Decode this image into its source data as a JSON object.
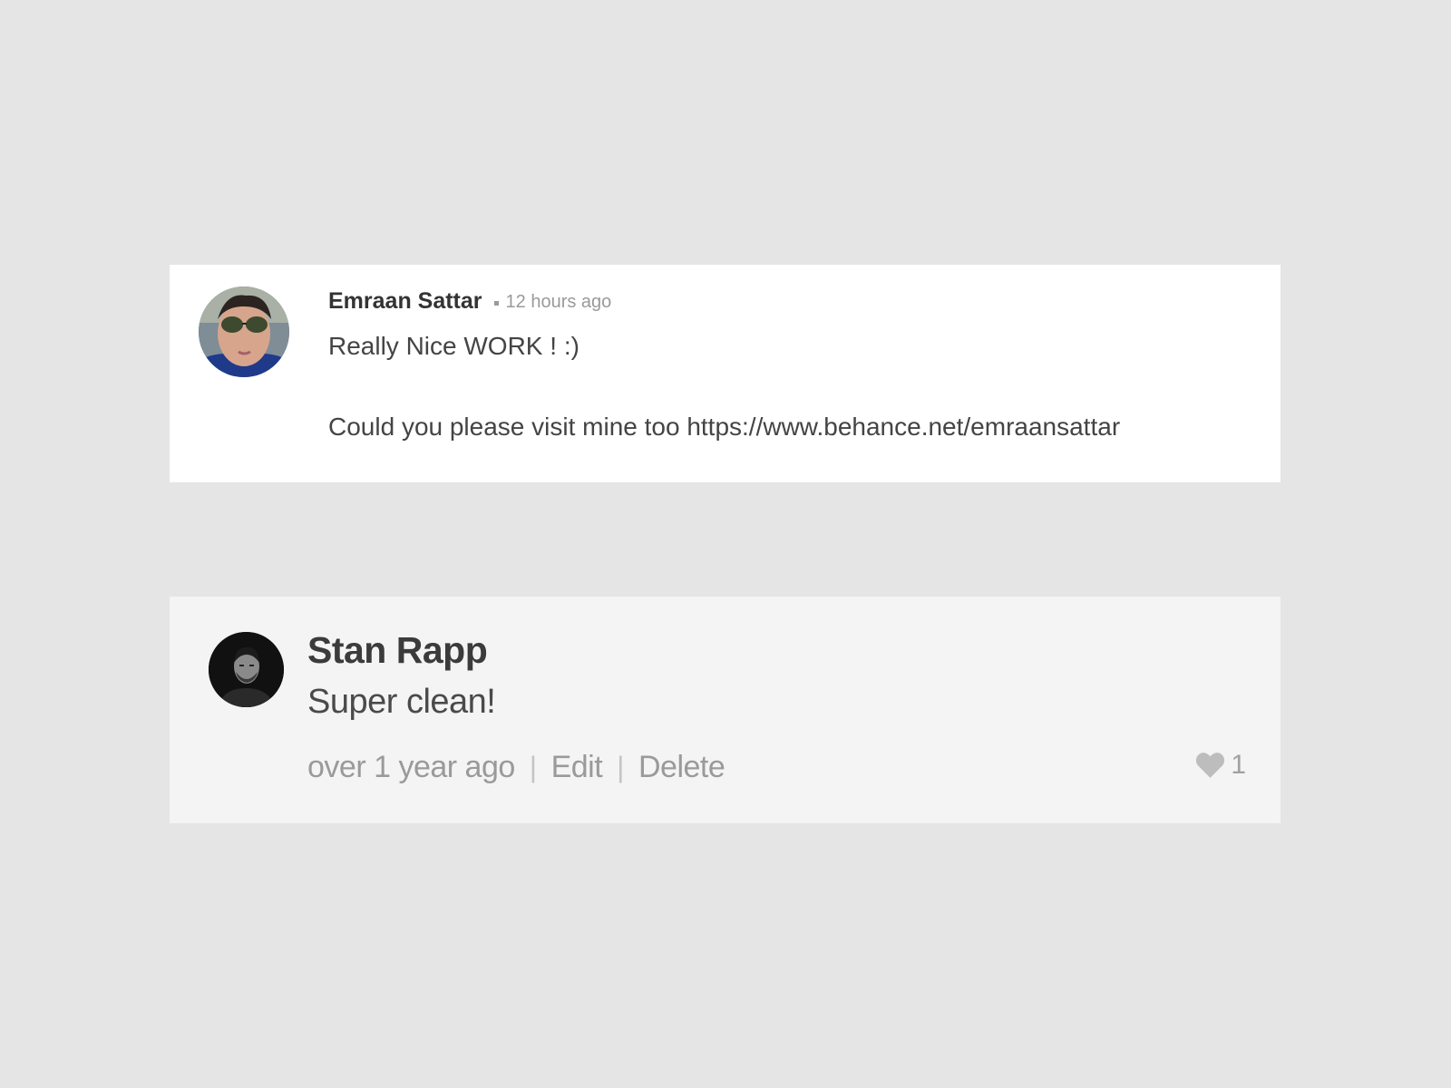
{
  "comment1": {
    "author": "Emraan Sattar",
    "time": "12 hours ago",
    "line1": "Really Nice WORK ! :)",
    "line2": "Could you please visit mine too https://www.behance.net/emraansattar",
    "avatar_icon": "user-avatar-sunglasses"
  },
  "comment2": {
    "author": "Stan Rapp",
    "text": "Super clean!",
    "time": "over 1 year ago",
    "separator": "|",
    "edit_label": "Edit",
    "delete_label": "Delete",
    "like_icon": "heart-icon",
    "like_count": "1",
    "avatar_icon": "user-avatar-monochrome"
  },
  "colors": {
    "page_background": "#e5e5e5",
    "card1_background": "#ffffff",
    "card2_background": "#f4f4f4",
    "muted_text": "#9a9a9a",
    "heart": "#bdbdbd"
  }
}
